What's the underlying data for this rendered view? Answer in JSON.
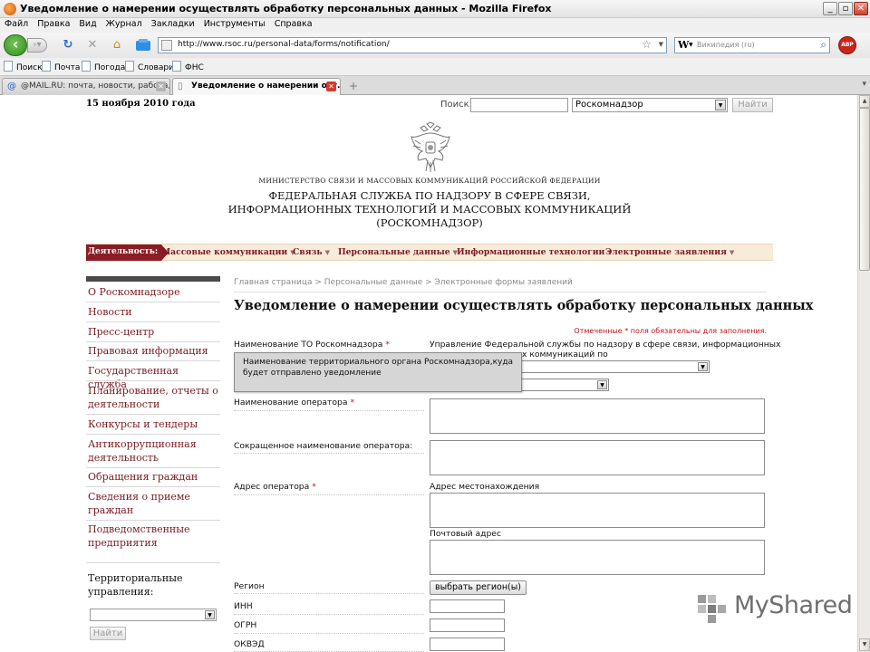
{
  "window": {
    "title": "Уведомление о намерении осуществлять обработку персональных данных - Mozilla Firefox",
    "minimize": "_",
    "maximize": "▫",
    "close": "✕"
  },
  "menu": [
    "Файл",
    "Правка",
    "Вид",
    "Журнал",
    "Закладки",
    "Инструменты",
    "Справка"
  ],
  "navbar": {
    "url": "http://www.rsoc.ru/personal-data/forms/notification/",
    "search_placeholder": "Википедия (ru)",
    "search_engine": "W",
    "adblock": "ABP"
  },
  "bookmarks": [
    "Поиск",
    "Почта",
    "Погода",
    "Словари",
    "ФНС"
  ],
  "tabs": [
    {
      "label": "@MAIL.RU: почта, новости, работа, ...",
      "active": false
    },
    {
      "label": "Уведомление о намерении осу...",
      "active": true
    }
  ],
  "page": {
    "date": "15 ноября 2010 года",
    "search_label": "Поиск:",
    "search_value": "",
    "search_scope": "Роскомнадзор",
    "search_button": "Найти",
    "ministry": "МИНИСТЕРСТВО СВЯЗИ И МАССОВЫХ КОММУНИКАЦИЙ РОССИЙСКОЙ ФЕДЕРАЦИИ",
    "service_lines": [
      "ФЕДЕРАЛЬНАЯ СЛУЖБА ПО НАДЗОРУ В СФЕРЕ СВЯЗИ,",
      "ИНФОРМАЦИОННЫХ ТЕХНОЛОГИЙ И МАССОВЫХ КОММУНИКАЦИЙ",
      "(РОСКОМНАДЗОР)"
    ],
    "nav": {
      "title": "Деятельность:",
      "items": [
        "Массовые коммуникации",
        "Связь",
        "Персональные данные",
        "Информационные технологии",
        "Электронные заявления"
      ]
    },
    "sidebar": {
      "items": [
        "О Роскомнадзоре",
        "Новости",
        "Пресс-центр",
        "Правовая информация",
        "Государственная служба",
        "Планирование, отчеты о деятельности",
        "Конкурсы и тендеры",
        "Антикоррупционная деятельность",
        "Обращения граждан",
        "Сведения о приеме граждан",
        "Подведомственные предприятия"
      ],
      "territorial_label": "Территориальные управления:",
      "territorial_value": "",
      "territorial_button": "Найти"
    },
    "breadcrumbs": "Главная страница > Персональные данные > Электронные формы заявлений",
    "title": "Уведомление о намерении осуществлять обработку персональных данных",
    "required_note": "Отмеченные * поля обязательны для заполнения.",
    "form": {
      "to_label": "Наименование ТО Роскомнадзора",
      "to_value_line1": "Управление Федеральной службы по надзору в сфере связи, информационных",
      "to_value_line2_visible": "х коммуникаций по",
      "tooltip": "Наименование территориального органа Роскомнадзора,куда будет отправлено уведомление",
      "operator_name_label": "Наименование оператора",
      "short_name_label": "Сокращенное наименование оператора:",
      "address_label": "Адрес оператора",
      "location_label": "Адрес местонахождения",
      "postal_label": "Почтовый адрес",
      "region_label": "Регион",
      "region_button": "выбрать регион(ы)",
      "inn_label": "ИНН",
      "ogrn_label": "ОГРН",
      "okved_label": "ОКВЭД",
      "required_mark": "*"
    }
  },
  "watermark": "MyShared"
}
